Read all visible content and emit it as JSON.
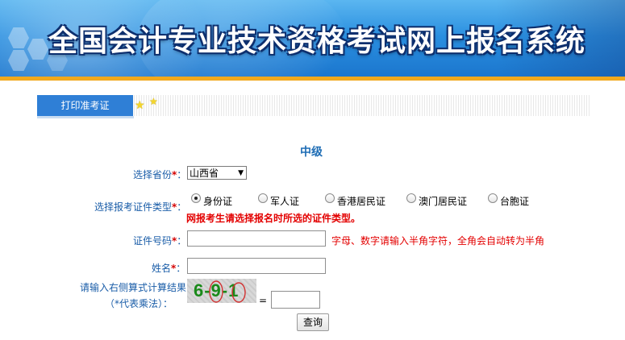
{
  "banner": {
    "title": "全国会计专业技术资格考试网上报名系统"
  },
  "tab": {
    "label": "打印准考证"
  },
  "form": {
    "level": "中级",
    "province_label": "选择省份",
    "province_value": "山西省",
    "id_type_label": "选择报考证件类型",
    "id_types": [
      "身份证",
      "军人证",
      "香港居民证",
      "澳门居民证",
      "台胞证"
    ],
    "id_type_selected": "身份证",
    "id_type_warning": "网报考生请选择报名时所选的证件类型。",
    "id_number_label": "证件号码",
    "id_number_hint": "字母、数字请输入半角字符，全角会自动转为半角",
    "name_label": "姓名",
    "captcha_label_line1": "请输入右侧算式计算结果",
    "captcha_label_line2": "（*代表乘法）：",
    "captcha_text": "6-9-1",
    "equals": "=",
    "required_mark": "*",
    "submit_label": "查询"
  },
  "colors": {
    "accent": "#2f7fd6",
    "label": "#1a5da8",
    "warning": "#e30000",
    "banner_stripe": "#f2a91c"
  }
}
